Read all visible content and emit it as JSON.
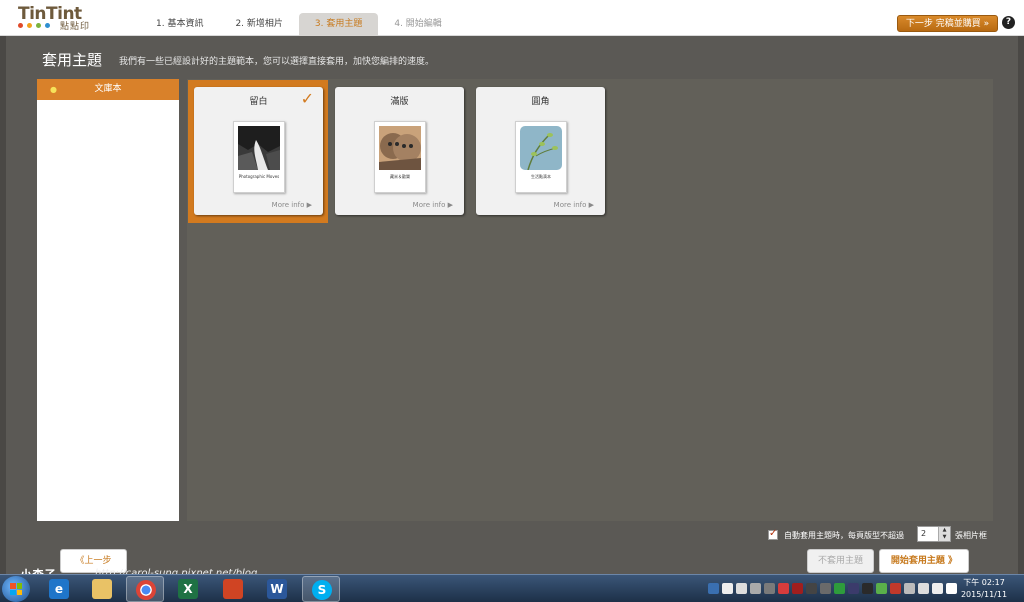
{
  "app": {
    "logo_main": "TinTint",
    "logo_sub": "點點印"
  },
  "steps": [
    {
      "label": "1. 基本資訊",
      "state": "done"
    },
    {
      "label": "2. 新增相片",
      "state": "done"
    },
    {
      "label": "3. 套用主題",
      "state": "active"
    },
    {
      "label": "4. 開始編輯",
      "state": "disabled"
    }
  ],
  "header": {
    "next_button": "下一步 完稿並購買 »",
    "help_icon": "question-icon",
    "help_label": "?"
  },
  "page": {
    "title": "套用主題",
    "description": "我們有一些已經設計好的主題範本，您可以選擇直接套用，加快您編排的速度。"
  },
  "sidebar": {
    "items": [
      {
        "label": "文庫本",
        "selected": true
      }
    ]
  },
  "themes": [
    {
      "name": "留白",
      "selected": true,
      "thumb_text": "Photographic Moves",
      "more_info": "More info"
    },
    {
      "name": "滿版",
      "selected": false,
      "thumb_text": "藏米＆歡樂",
      "more_info": "More info"
    },
    {
      "name": "圓角",
      "selected": false,
      "thumb_text": "生活點滴本",
      "more_info": "More info"
    }
  ],
  "options": {
    "auto_apply_label": "自動套用主題時，每頁版型不超過",
    "auto_apply_checked": true,
    "max_photos": "2",
    "frame_label": "張相片框"
  },
  "buttons": {
    "prev": "《上一步",
    "no_apply": "不套用主題",
    "apply": "開始套用主題 》"
  },
  "watermark": {
    "name": "小森子",
    "url": "http://carol-sung.pixnet.net/blog"
  },
  "taskbar": {
    "time": "下午 02:17",
    "date": "2015/11/11"
  },
  "colors": {
    "accent": "#d27a1f",
    "panel": "#5b5955",
    "theme_area": "#626059"
  }
}
